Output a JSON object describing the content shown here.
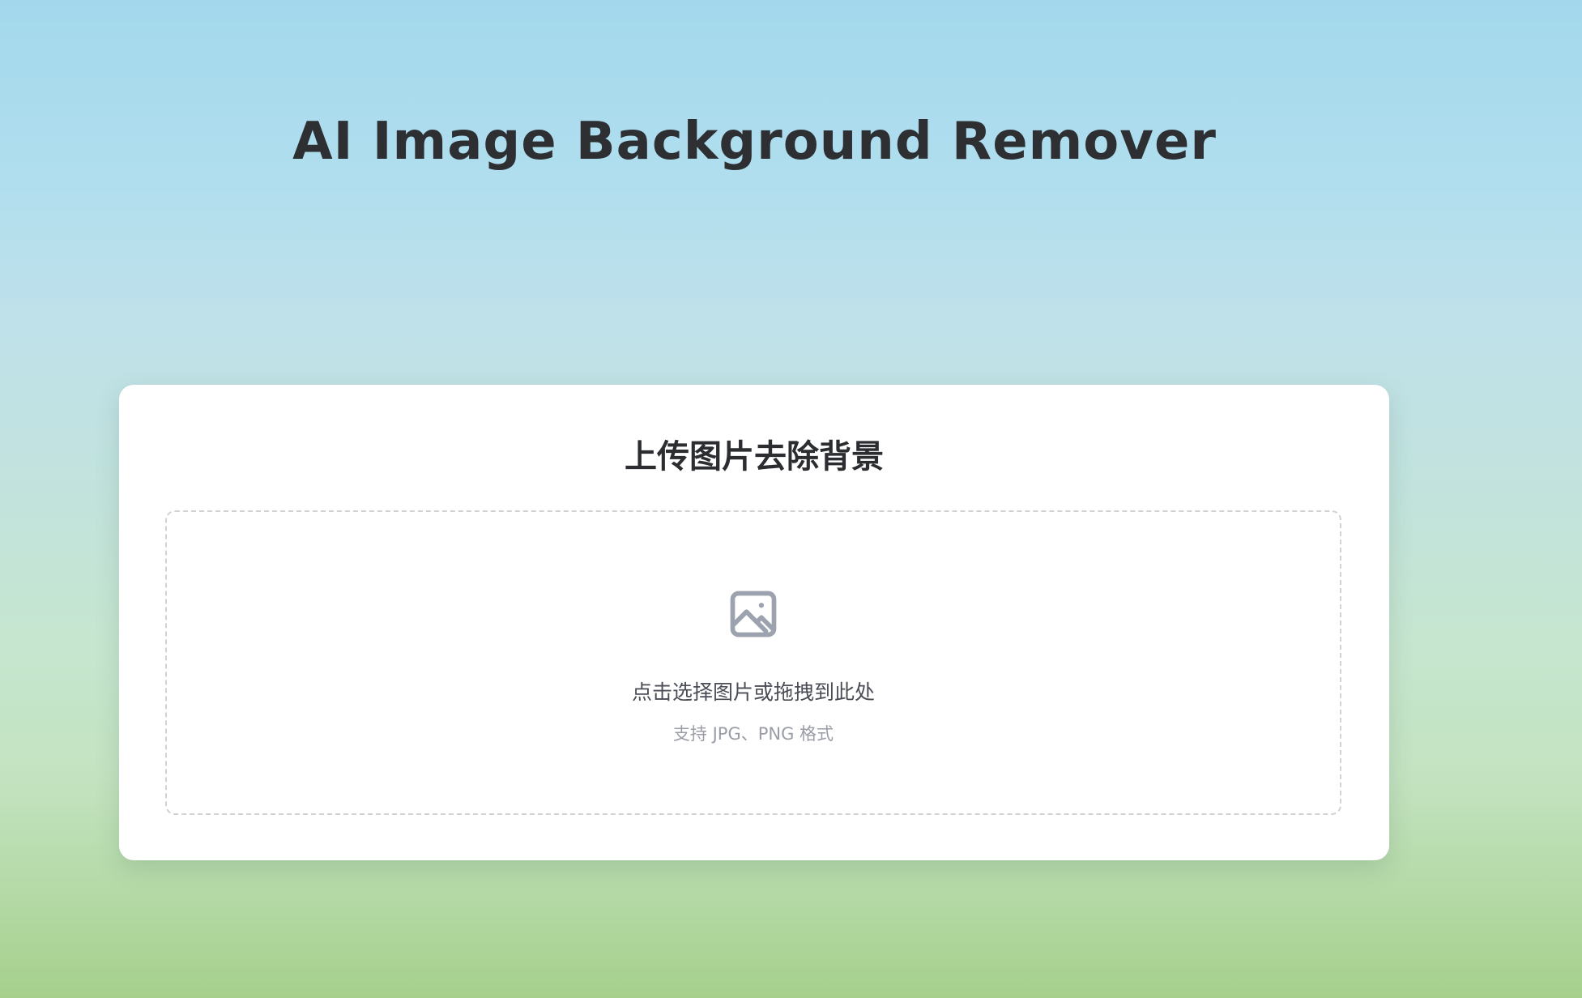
{
  "header": {
    "title": "AI Image Background Remover"
  },
  "upload_card": {
    "title": "上传图片去除背景",
    "drop_zone": {
      "icon": "image-icon",
      "prompt": "点击选择图片或拖拽到此处",
      "hint": "支持 JPG、PNG 格式"
    }
  },
  "colors": {
    "icon": "#9ca3af",
    "title_text": "#2d2f33",
    "dashed_border": "#d0d2d6",
    "background_top": "#a3d8ec",
    "background_bottom": "#a5d08b"
  }
}
